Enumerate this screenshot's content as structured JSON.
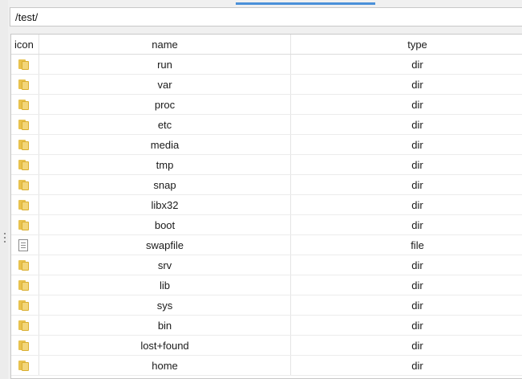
{
  "path": {
    "value": "/test/"
  },
  "table": {
    "columns": {
      "icon": "icon",
      "name": "name",
      "type": "type"
    },
    "rows": [
      {
        "icon": "folder-icon",
        "name": "run",
        "type": "dir"
      },
      {
        "icon": "folder-icon",
        "name": "var",
        "type": "dir"
      },
      {
        "icon": "folder-icon",
        "name": "proc",
        "type": "dir"
      },
      {
        "icon": "folder-icon",
        "name": "etc",
        "type": "dir"
      },
      {
        "icon": "folder-icon",
        "name": "media",
        "type": "dir"
      },
      {
        "icon": "folder-icon",
        "name": "tmp",
        "type": "dir"
      },
      {
        "icon": "folder-icon",
        "name": "snap",
        "type": "dir"
      },
      {
        "icon": "folder-icon",
        "name": "libx32",
        "type": "dir"
      },
      {
        "icon": "folder-icon",
        "name": "boot",
        "type": "dir"
      },
      {
        "icon": "file-icon",
        "name": "swapfile",
        "type": "file"
      },
      {
        "icon": "folder-icon",
        "name": "srv",
        "type": "dir"
      },
      {
        "icon": "folder-icon",
        "name": "lib",
        "type": "dir"
      },
      {
        "icon": "folder-icon",
        "name": "sys",
        "type": "dir"
      },
      {
        "icon": "folder-icon",
        "name": "bin",
        "type": "dir"
      },
      {
        "icon": "folder-icon",
        "name": "lost+found",
        "type": "dir"
      },
      {
        "icon": "folder-icon",
        "name": "home",
        "type": "dir"
      }
    ]
  },
  "colors": {
    "accent": "#4a90d9",
    "folder": "#f3d67a",
    "border": "#c8c8c8"
  }
}
